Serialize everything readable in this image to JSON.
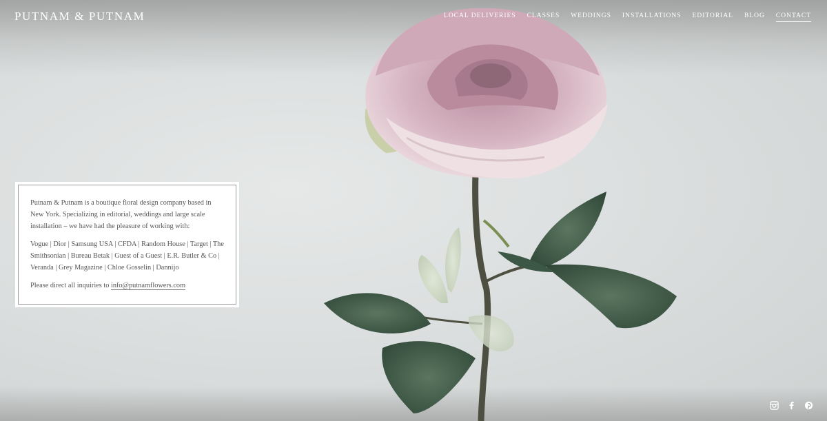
{
  "header": {
    "logo": "PUTNAM & PUTNAM",
    "nav": [
      {
        "label": "LOCAL DELIVERIES"
      },
      {
        "label": "CLASSES"
      },
      {
        "label": "WEDDINGS"
      },
      {
        "label": "INSTALLATIONS"
      },
      {
        "label": "EDITORIAL"
      },
      {
        "label": "BLOG"
      },
      {
        "label": "CONTACT",
        "active": true
      }
    ]
  },
  "info": {
    "intro": "Putnam & Putnam is a boutique floral design company based in New York.  Specializing in editorial, weddings and large scale installation – we have had the pleasure of working with:",
    "clients": "Vogue | Dior | Samsung USA | CFDA | Random House | Target | The Smithsonian | Bureau Betak | Guest of a Guest | E.R. Butler & Co | Veranda | Grey Magazine | Chloe Gosselin | Dannijo",
    "inquiry_prefix": "Please direct all inquiries to ",
    "email": "info@putnamflowers.com"
  },
  "social": {
    "icons": [
      "instagram-icon",
      "facebook-icon",
      "pinterest-icon"
    ]
  },
  "colors": {
    "background": "#dcdfdf",
    "petal": "#d7b8c4",
    "leaf": "#3f5a48",
    "stem": "#5a5a4a"
  }
}
